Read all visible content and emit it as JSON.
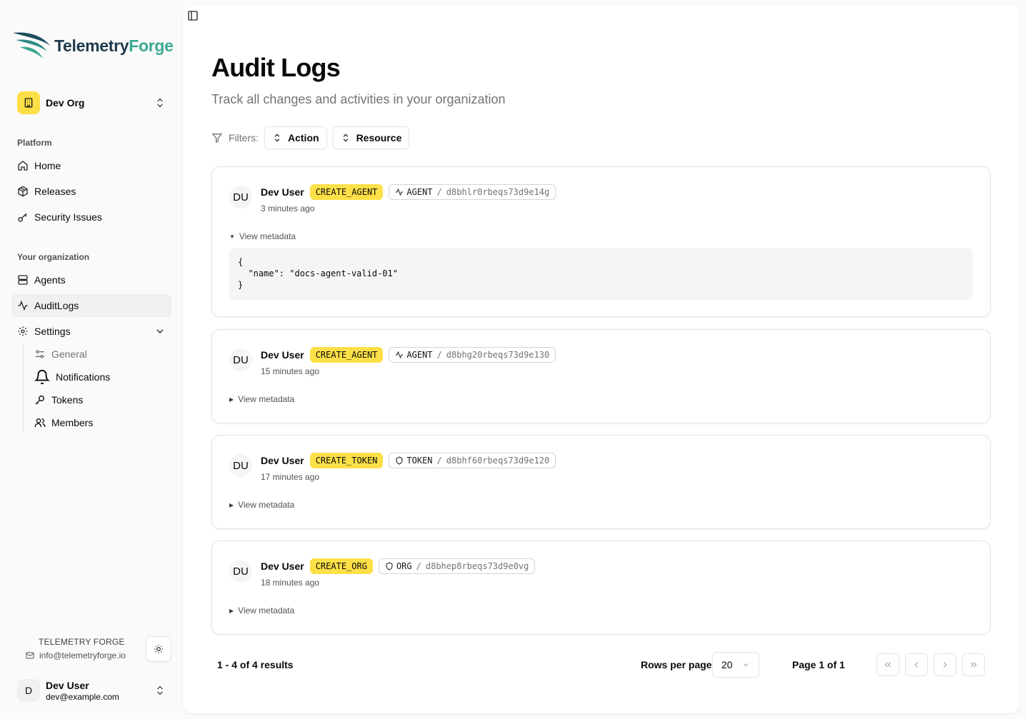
{
  "brand": {
    "name_part1": "Telemetry",
    "name_part2": "Forge"
  },
  "org": {
    "name": "Dev Org"
  },
  "sidebar": {
    "platform_label": "Platform",
    "platform_items": [
      {
        "label": "Home",
        "icon": "home-icon"
      },
      {
        "label": "Releases",
        "icon": "package-icon"
      },
      {
        "label": "Security Issues",
        "icon": "key-icon"
      }
    ],
    "org_label": "Your organization",
    "org_items": [
      {
        "label": "Agents",
        "icon": "server-icon"
      },
      {
        "label": "AuditLogs",
        "icon": "activity-icon",
        "active": true
      },
      {
        "label": "Settings",
        "icon": "gear-icon",
        "expanded": true
      }
    ],
    "settings_items": [
      {
        "label": "General",
        "icon": "sliders-icon"
      },
      {
        "label": "Notifications",
        "icon": "bell-icon"
      },
      {
        "label": "Tokens",
        "icon": "key-icon"
      },
      {
        "label": "Members",
        "icon": "users-icon"
      }
    ],
    "footer_brand": "TELEMETRY FORGE",
    "footer_email": "info@telemetryforge.io"
  },
  "user": {
    "initial": "D",
    "name": "Dev User",
    "email": "dev@example.com"
  },
  "page": {
    "title": "Audit Logs",
    "subtitle": "Track all changes and activities in your organization"
  },
  "filters": {
    "label": "Filters:",
    "action": "Action",
    "resource": "Resource"
  },
  "logs": [
    {
      "initials": "DU",
      "user": "Dev User",
      "action": "CREATE_AGENT",
      "resource_type": "AGENT",
      "separator": "/",
      "resource_id": "d8bhlr0rbeqs73d9e14g",
      "time": "3 minutes ago",
      "meta_label": "View metadata",
      "expanded": true,
      "metadata": "{\n  \"name\": \"docs-agent-valid-01\"\n}"
    },
    {
      "initials": "DU",
      "user": "Dev User",
      "action": "CREATE_AGENT",
      "resource_type": "AGENT",
      "separator": "/",
      "resource_id": "d8bhg20rbeqs73d9e130",
      "time": "15 minutes ago",
      "meta_label": "View metadata",
      "expanded": false
    },
    {
      "initials": "DU",
      "user": "Dev User",
      "action": "CREATE_TOKEN",
      "resource_type": "TOKEN",
      "separator": "/",
      "resource_id": "d8bhf60rbeqs73d9e120",
      "time": "17 minutes ago",
      "meta_label": "View metadata",
      "expanded": false
    },
    {
      "initials": "DU",
      "user": "Dev User",
      "action": "CREATE_ORG",
      "resource_type": "ORG",
      "separator": "/",
      "resource_id": "d8bhep8rbeqs73d9e0vg",
      "time": "18 minutes ago",
      "meta_label": "View metadata",
      "expanded": false
    }
  ],
  "pagination": {
    "results": "1 - 4 of 4 results",
    "rows_per_page_label": "Rows per page",
    "rows_per_page": "20",
    "page_of": "Page 1 of 1"
  },
  "colors": {
    "accent_yellow": "#fde047",
    "brand_dark": "#1f3a4d",
    "brand_teal": "#3aa892"
  }
}
